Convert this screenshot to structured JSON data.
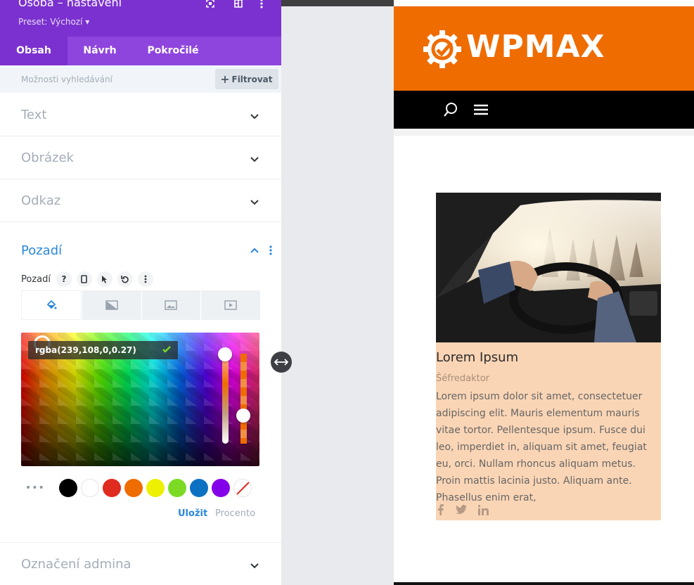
{
  "panel": {
    "title": "Osoba – nastavení",
    "preset": "Preset: Výchozí ▾",
    "tabs": [
      {
        "label": "Obsah"
      },
      {
        "label": "Návrh"
      },
      {
        "label": "Pokročilé"
      }
    ],
    "search_placeholder": "Možnosti vyhledávání",
    "filter_label": "Filtrovat",
    "sections": [
      {
        "label": "Text"
      },
      {
        "label": "Obrázek"
      },
      {
        "label": "Odkaz"
      }
    ],
    "open_section": {
      "label": "Pozadí",
      "field_label": "Pozadí",
      "help": "?",
      "color_value": "rgba(239,108,0,0.27)",
      "swatches": [
        "#000000",
        "#ffffff",
        "#e02b20",
        "#ef6c00",
        "#edf000",
        "#7cda24",
        "#0c71c3",
        "#8300e9"
      ],
      "save_label": "Uložit",
      "percent_label": "Procento"
    },
    "admin_section": "Označení admina"
  },
  "preview": {
    "logo": "WPMAX",
    "header_color": "#ef6c00",
    "person": {
      "name": "Lorem Ipsum",
      "position": "Šéfredaktor",
      "bio": "Lorem ipsum dolor sit amet, consectetuer adipiscing elit. Mauris elementum mauris vitae tortor. Pellentesque ipsum. Fusce dui leo, imperdiet in, aliquam sit amet, feugiat eu, orci. Nullam rhoncus aliquam metus. Proin mattis lacinia justo. Aliquam ante. Phasellus enim erat,"
    },
    "social_icons": [
      "facebook-icon",
      "twitter-icon",
      "linkedin-icon"
    ]
  }
}
